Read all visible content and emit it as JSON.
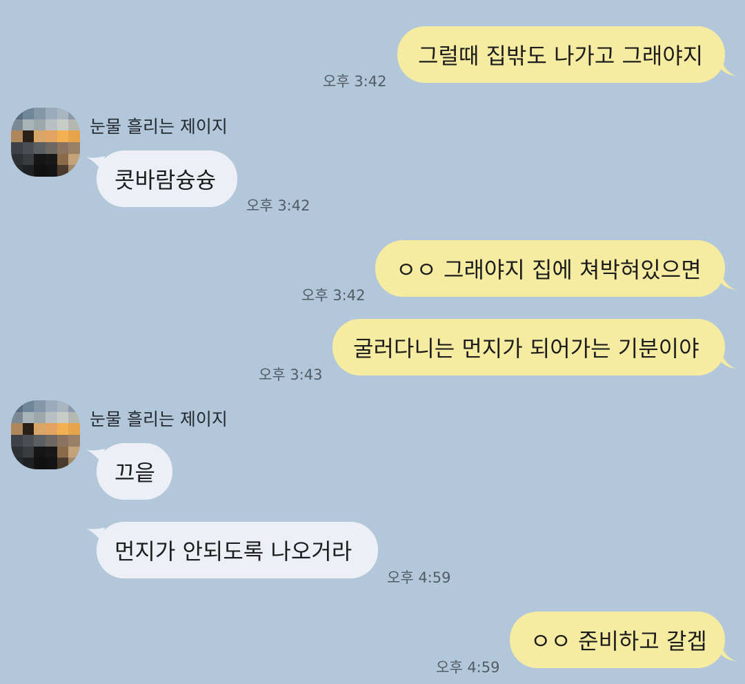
{
  "chat": {
    "sender_name": "눈물 흘리는 제이지",
    "messages": [
      {
        "text": "그럴때 집밖도 나가고 그래야지",
        "time": "오후 3:42"
      },
      {
        "text": "콧바람슝슝",
        "time": "오후 3:42"
      },
      {
        "text": "ㅇㅇ 그래야지 집에 쳐박혀있으면",
        "time": "오후 3:42"
      },
      {
        "text": "굴러다니는 먼지가 되어가는 기분이야",
        "time": "오후 3:43"
      },
      {
        "text": "끄읕"
      },
      {
        "text": "먼지가 안되도록 나오거라",
        "time": "오후 4:59"
      },
      {
        "text": "ㅇㅇ 준비하고 갈겝",
        "time": "오후 4:59"
      }
    ]
  },
  "colors": {
    "background": "#b2c7da",
    "outgoing_bubble": "#f5eba1",
    "incoming_bubble": "#ecf0f6"
  },
  "avatar": {
    "icon": "pixelated-profile-photo",
    "pixels": [
      "#5b6e82",
      "#6f8598",
      "#8497a8",
      "#9aacbc",
      "#a8b6c2",
      "#8a9aa8",
      "#7b8a92",
      "#a8b4b8",
      "#9ea8aa",
      "#b9c0c4",
      "#c8ccc8",
      "#b4b8b0",
      "#b0875a",
      "#2a2018",
      "#d9a66a",
      "#e2a460",
      "#f2b050",
      "#e8a44a",
      "#3e4246",
      "#4a4e52",
      "#5c5f62",
      "#6e6862",
      "#8a7460",
      "#9a8066",
      "#2e3034",
      "#3a3c40",
      "#151515",
      "#181818",
      "#8a6a48",
      "#c4a27a",
      "#262a2e",
      "#1e2024",
      "#111111",
      "#131313",
      "#4a3a2c",
      "#a08a6c"
    ]
  }
}
